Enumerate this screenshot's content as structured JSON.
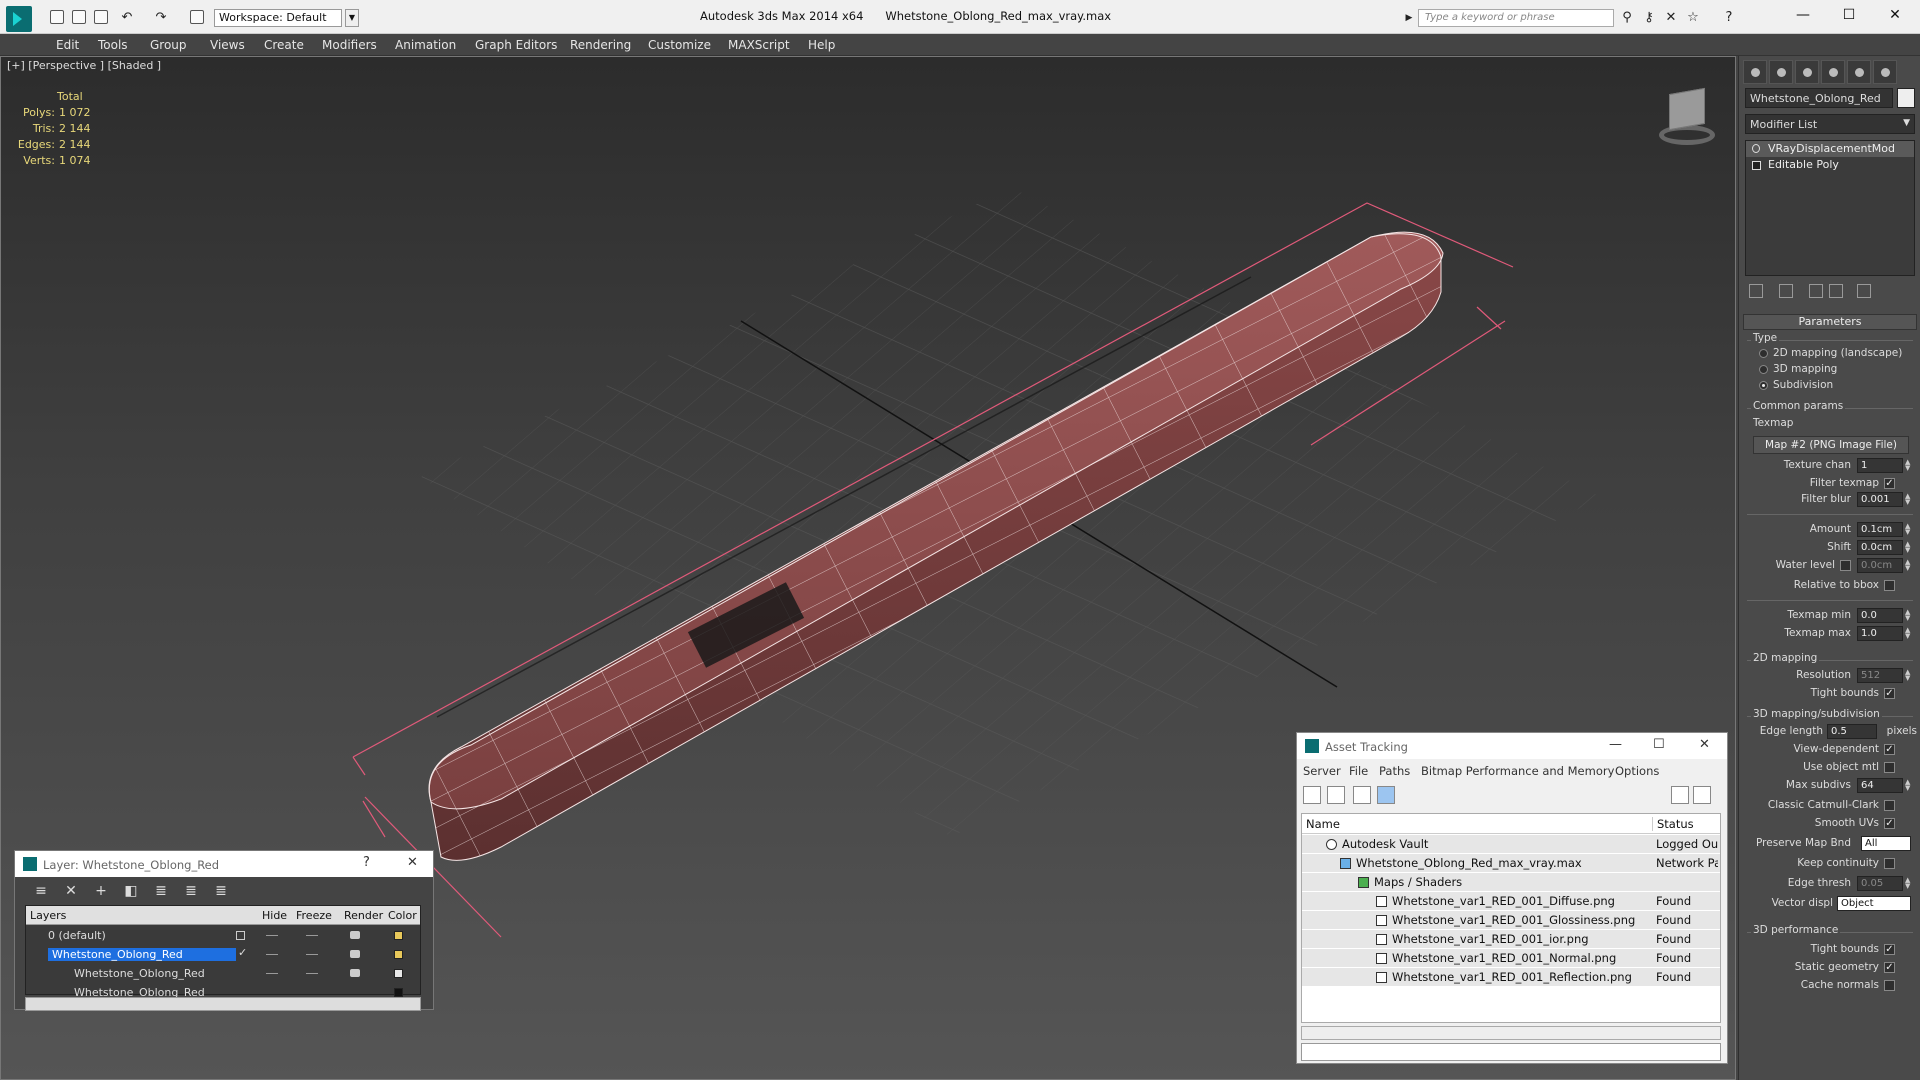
{
  "titlebar": {
    "workspace": "Workspace: Default",
    "app_name": "Autodesk 3ds Max  2014 x64",
    "file_name": "Whetstone_Oblong_Red_max_vray.max",
    "search_placeholder": "Type a keyword or phrase"
  },
  "menu": [
    "Edit",
    "Tools",
    "Group",
    "Views",
    "Create",
    "Modifiers",
    "Animation",
    "Graph Editors",
    "Rendering",
    "Customize",
    "MAXScript",
    "Help"
  ],
  "viewport": {
    "label": "[+] [Perspective ] [Shaded ]",
    "stats": {
      "header": "Total",
      "rows": [
        {
          "k": "Polys:",
          "v": "1 072"
        },
        {
          "k": "Tris:",
          "v": "2 144"
        },
        {
          "k": "Edges:",
          "v": "2 144"
        },
        {
          "k": "Verts:",
          "v": "1 074"
        }
      ]
    },
    "object_color": "#8a4a4a",
    "bbox_color": "#e05a7a"
  },
  "command_panel": {
    "object_name": "Whetstone_Oblong_Red",
    "modifier_list": "Modifier List",
    "stack": [
      "VRayDisplacementMod",
      "Editable Poly"
    ],
    "parameters_title": "Parameters",
    "type_label": "Type",
    "type_options": [
      "2D mapping (landscape)",
      "3D mapping",
      "Subdivision"
    ],
    "common_params": "Common params",
    "texmap_label": "Texmap",
    "texmap_button": "Map #2 (PNG Image File)",
    "texture_chan": {
      "label": "Texture chan",
      "value": "1"
    },
    "filter_texmap": "Filter texmap",
    "filter_blur": {
      "label": "Filter blur",
      "value": "0.001"
    },
    "amount": {
      "label": "Amount",
      "value": "0.1cm"
    },
    "shift": {
      "label": "Shift",
      "value": "0.0cm"
    },
    "water_level": {
      "label": "Water level",
      "value": "0.0cm"
    },
    "relative_bbox": "Relative to bbox",
    "texmap_min": {
      "label": "Texmap min",
      "value": "0.0"
    },
    "texmap_max": {
      "label": "Texmap max",
      "value": "1.0"
    },
    "mapping_2d": "2D mapping",
    "resolution": {
      "label": "Resolution",
      "value": "512"
    },
    "tight_bounds_2d": "Tight bounds",
    "mapping_3d": "3D mapping/subdivision",
    "edge_length": {
      "label": "Edge length",
      "value": "0.5",
      "unit": "pixels"
    },
    "view_dependent": "View-dependent",
    "use_object_mtl": "Use object mtl",
    "max_subdivs": {
      "label": "Max subdivs",
      "value": "64"
    },
    "classic_catmull": "Classic Catmull-Clark",
    "smooth_uvs": "Smooth UVs",
    "preserve_map_bnd": {
      "label": "Preserve Map Bnd",
      "value": "All"
    },
    "keep_continuity": "Keep continuity",
    "edge_thresh": {
      "label": "Edge thresh",
      "value": "0.05"
    },
    "vector_displ": {
      "label": "Vector displ",
      "value": "Object"
    },
    "performance_3d": "3D performance",
    "tight_bounds_3d": "Tight bounds",
    "static_geometry": "Static geometry",
    "cache_normals": "Cache normals"
  },
  "layer_dialog": {
    "title": "Layer: Whetstone_Oblong_Red",
    "help": "?",
    "columns": [
      "Layers",
      "Hide",
      "Freeze",
      "Render",
      "Color"
    ],
    "rows": [
      {
        "name": "0 (default)",
        "color": "#e8c85a"
      },
      {
        "name": "Whetstone_Oblong_Red",
        "color": "#e8c85a"
      },
      {
        "name": "Whetstone_Oblong_Red",
        "color": "#e8e8e8"
      },
      {
        "name": "Whetstone_Oblong_Red",
        "color": "#111111"
      }
    ]
  },
  "asset_dialog": {
    "title": "Asset Tracking",
    "menu": [
      "Server",
      "File",
      "Paths",
      "Bitmap Performance and Memory",
      "Options"
    ],
    "columns": [
      "Name",
      "Status"
    ],
    "rows": [
      {
        "name": "Autodesk Vault",
        "status": "Logged Out"
      },
      {
        "name": "Whetstone_Oblong_Red_max_vray.max",
        "status": "Network Pa"
      },
      {
        "name": "Maps / Shaders",
        "status": ""
      },
      {
        "name": "Whetstone_var1_RED_001_Diffuse.png",
        "status": "Found"
      },
      {
        "name": "Whetstone_var1_RED_001_Glossiness.png",
        "status": "Found"
      },
      {
        "name": "Whetstone_var1_RED_001_ior.png",
        "status": "Found"
      },
      {
        "name": "Whetstone_var1_RED_001_Normal.png",
        "status": "Found"
      },
      {
        "name": "Whetstone_var1_RED_001_Reflection.png",
        "status": "Found"
      }
    ]
  }
}
